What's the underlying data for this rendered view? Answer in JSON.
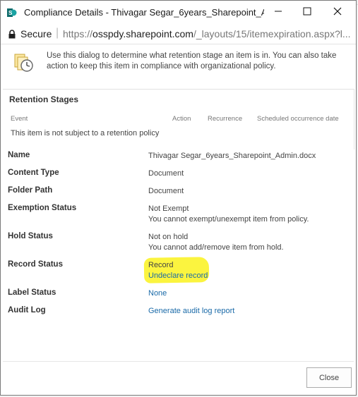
{
  "window": {
    "title": "Compliance Details - Thivagar Segar_6years_Sharepoint_Adm..."
  },
  "address": {
    "secure_label": "Secure",
    "url_scheme": "https://",
    "url_host": "osspdy.sharepoint.com",
    "url_path": "/_layouts/15/itemexpiration.aspx?l..."
  },
  "dialog": {
    "intro_text": "Use this dialog to determine what retention stage an item is in. You can also take action to keep this item in compliance with organizational policy.",
    "retention": {
      "title": "Retention Stages",
      "columns": {
        "event": "Event",
        "action": "Action",
        "recurrence": "Recurrence",
        "scheduled": "Scheduled occurrence date"
      },
      "empty_message": "This item is not subject to a retention policy"
    },
    "properties": {
      "name": {
        "label": "Name",
        "value": "Thivagar Segar_6years_Sharepoint_Admin.docx"
      },
      "content_type": {
        "label": "Content Type",
        "value": "Document"
      },
      "folder_path": {
        "label": "Folder Path",
        "value": "Document"
      },
      "exemption_status": {
        "label": "Exemption Status",
        "value": "Not Exempt",
        "note": "You cannot exempt/unexempt item from policy."
      },
      "hold_status": {
        "label": "Hold Status",
        "value": "Not on hold",
        "note": "You cannot add/remove item from hold."
      },
      "record_status": {
        "label": "Record Status",
        "value": "Record",
        "link": "Undeclare record"
      },
      "label_status": {
        "label": "Label Status",
        "link": "None"
      },
      "audit_log": {
        "label": "Audit Log",
        "link": "Generate audit log report"
      }
    },
    "close_label": "Close"
  },
  "colors": {
    "link": "#1a6aa8",
    "highlight": "#fbf43f",
    "secure_lock": "#1f1f1f"
  },
  "icons": {
    "app": "sharepoint-app-icon",
    "lock": "lock-icon",
    "intro": "document-clock-icon"
  }
}
